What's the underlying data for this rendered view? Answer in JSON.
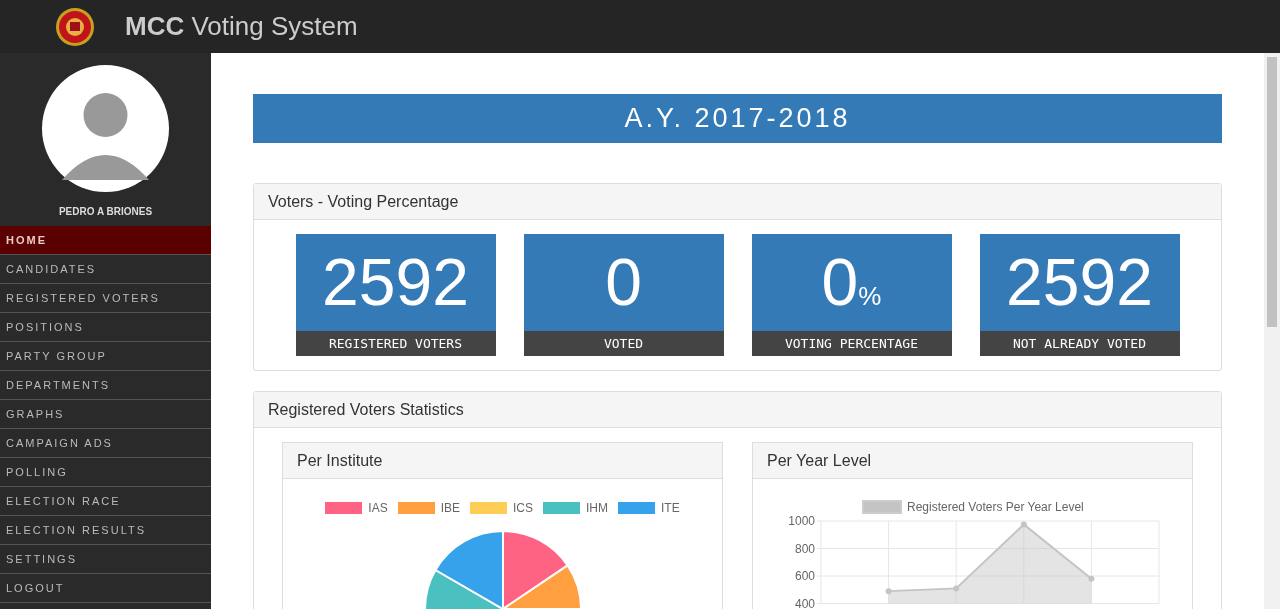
{
  "header": {
    "title_bold": "MCC",
    "title": "Voting System"
  },
  "user": {
    "name": "PEDRO A BRIONES"
  },
  "menu": [
    {
      "label": "HOME",
      "selected": true
    },
    {
      "label": "CANDIDATES",
      "selected": false
    },
    {
      "label": "REGISTERED VOTERS",
      "selected": false
    },
    {
      "label": "POSITIONS",
      "selected": false
    },
    {
      "label": "PARTY GROUP",
      "selected": false
    },
    {
      "label": "DEPARTMENTS",
      "selected": false
    },
    {
      "label": "GRAPHS",
      "selected": false
    },
    {
      "label": "CAMPAIGN ADS",
      "selected": false
    },
    {
      "label": "POLLING",
      "selected": false
    },
    {
      "label": "ELECTION RACE",
      "selected": false
    },
    {
      "label": "ELECTION RESULTS",
      "selected": false
    },
    {
      "label": "SETTINGS",
      "selected": false
    },
    {
      "label": "LOGOUT",
      "selected": false
    }
  ],
  "banner": "A.Y. 2017-2018",
  "voting_panel": {
    "title": "Voters - Voting Percentage",
    "stats": [
      {
        "number": "2592",
        "label": "REGISTERED VOTERS"
      },
      {
        "number": "0",
        "label": "VOTED"
      },
      {
        "number": "0",
        "unit": "%",
        "label": "VOTING PERCENTAGE"
      },
      {
        "number": "2592",
        "label": "NOT ALREADY VOTED"
      }
    ]
  },
  "statistics_panel": {
    "title": "Registered Voters Statistics",
    "per_institute": {
      "title": "Per Institute",
      "legend": [
        {
          "label": "IAS",
          "color": "#ff6384"
        },
        {
          "label": "IBE",
          "color": "#ff9f40"
        },
        {
          "label": "ICS",
          "color": "#ffcd56"
        },
        {
          "label": "IHM",
          "color": "#4bc0c0"
        },
        {
          "label": "ITE",
          "color": "#36a2eb"
        }
      ]
    },
    "per_year_level": {
      "title": "Per Year Level",
      "chart_data": {
        "type": "area",
        "categories": [
          null,
          null,
          null,
          null
        ],
        "ylim": [
          400,
          1000
        ],
        "grid": true,
        "yticks": [
          400,
          600,
          800,
          1000
        ],
        "series": [
          {
            "name": "Registered Voters Per Year Level",
            "color": "#c4c4c4",
            "values": [
              490,
              510,
              975,
              580
            ]
          }
        ]
      }
    }
  }
}
